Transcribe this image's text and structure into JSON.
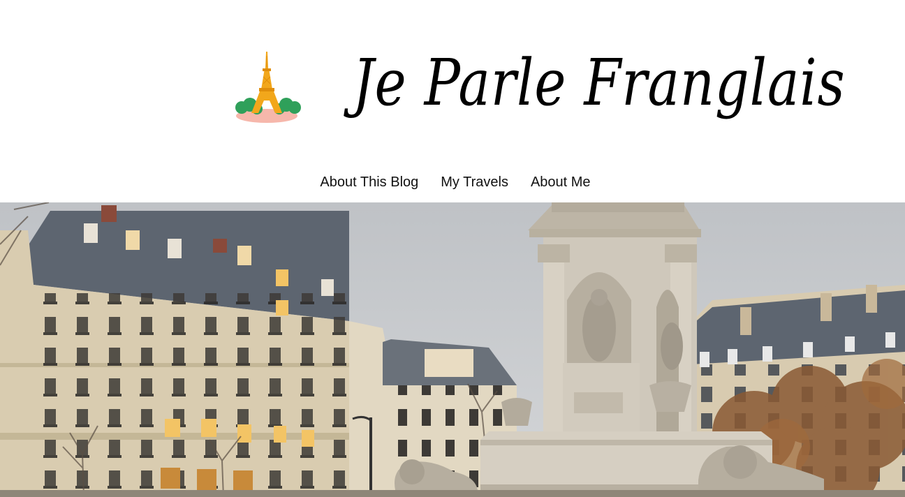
{
  "site": {
    "title": "Je Parle Franglais",
    "logo_icon": "eiffel-tower-icon"
  },
  "nav": {
    "items": [
      {
        "label": "About This Blog"
      },
      {
        "label": "My Travels"
      },
      {
        "label": "About Me"
      }
    ]
  },
  "hero": {
    "scene": "paris-fountain-photo"
  },
  "colors": {
    "sky": "#c9ccd0",
    "facade": "#d9ccb0",
    "roof": "#5d6570",
    "stone": "#cfc8bb",
    "window_light": "#f3c465",
    "tower": "#f2a71b",
    "tree": "#2fa05a"
  }
}
